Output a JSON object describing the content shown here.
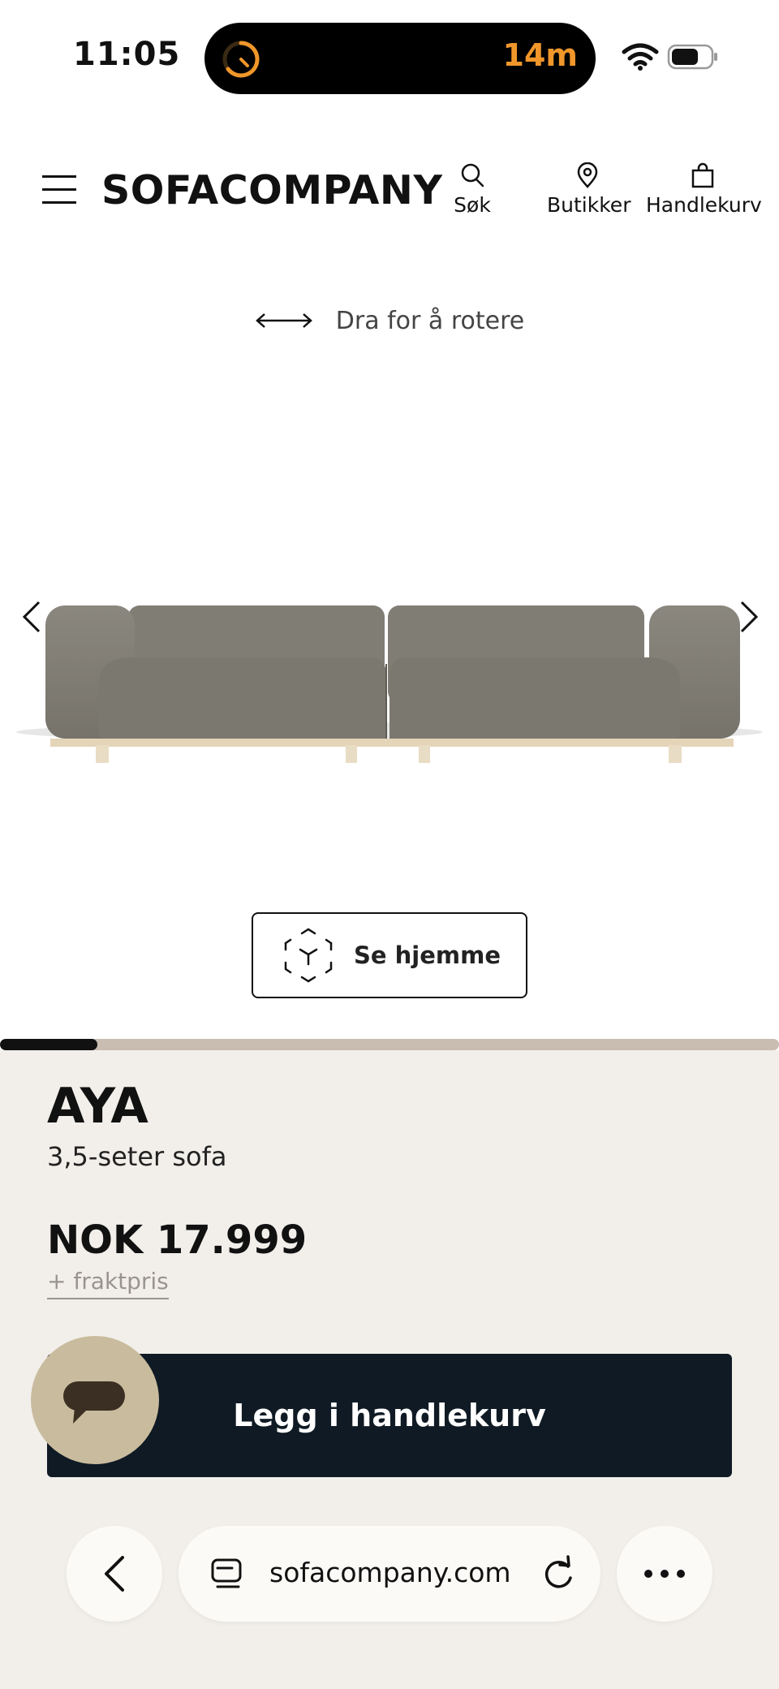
{
  "status_bar": {
    "time": "11:05",
    "island_timer": "14m",
    "accent_color": "#f0962a"
  },
  "header": {
    "logo": "SOFACOMPANY",
    "nav": {
      "search_label": "Søk",
      "stores_label": "Butikker",
      "cart_label": "Handlekurv"
    }
  },
  "viewer": {
    "rotate_hint": "Dra for å rotere",
    "ar_button_label": "Se hjemme",
    "carousel_progress": 0.125
  },
  "product": {
    "name": "AYA",
    "type": "3,5-seter sofa",
    "price": "NOK 17.999",
    "shipping_note": "+ fraktpris",
    "add_to_cart_label": "Legg i handlekurv"
  },
  "browser": {
    "url": "sofacompany.com"
  },
  "icons": [
    "hamburger-icon",
    "search-icon",
    "location-pin-icon",
    "shopping-bag-icon",
    "rotate-arrows-icon",
    "chevron-left-icon",
    "chevron-right-icon",
    "ar-cube-icon",
    "chat-icon",
    "back-icon",
    "tabs-icon",
    "reload-icon",
    "more-icon",
    "wifi-icon",
    "battery-icon",
    "timer-icon"
  ],
  "colors": {
    "panel_bg": "#f2efeb",
    "cart_button": "#0f1a24",
    "chat_bubble": "#c9bc9e",
    "progress_track": "#c9bcb0"
  }
}
